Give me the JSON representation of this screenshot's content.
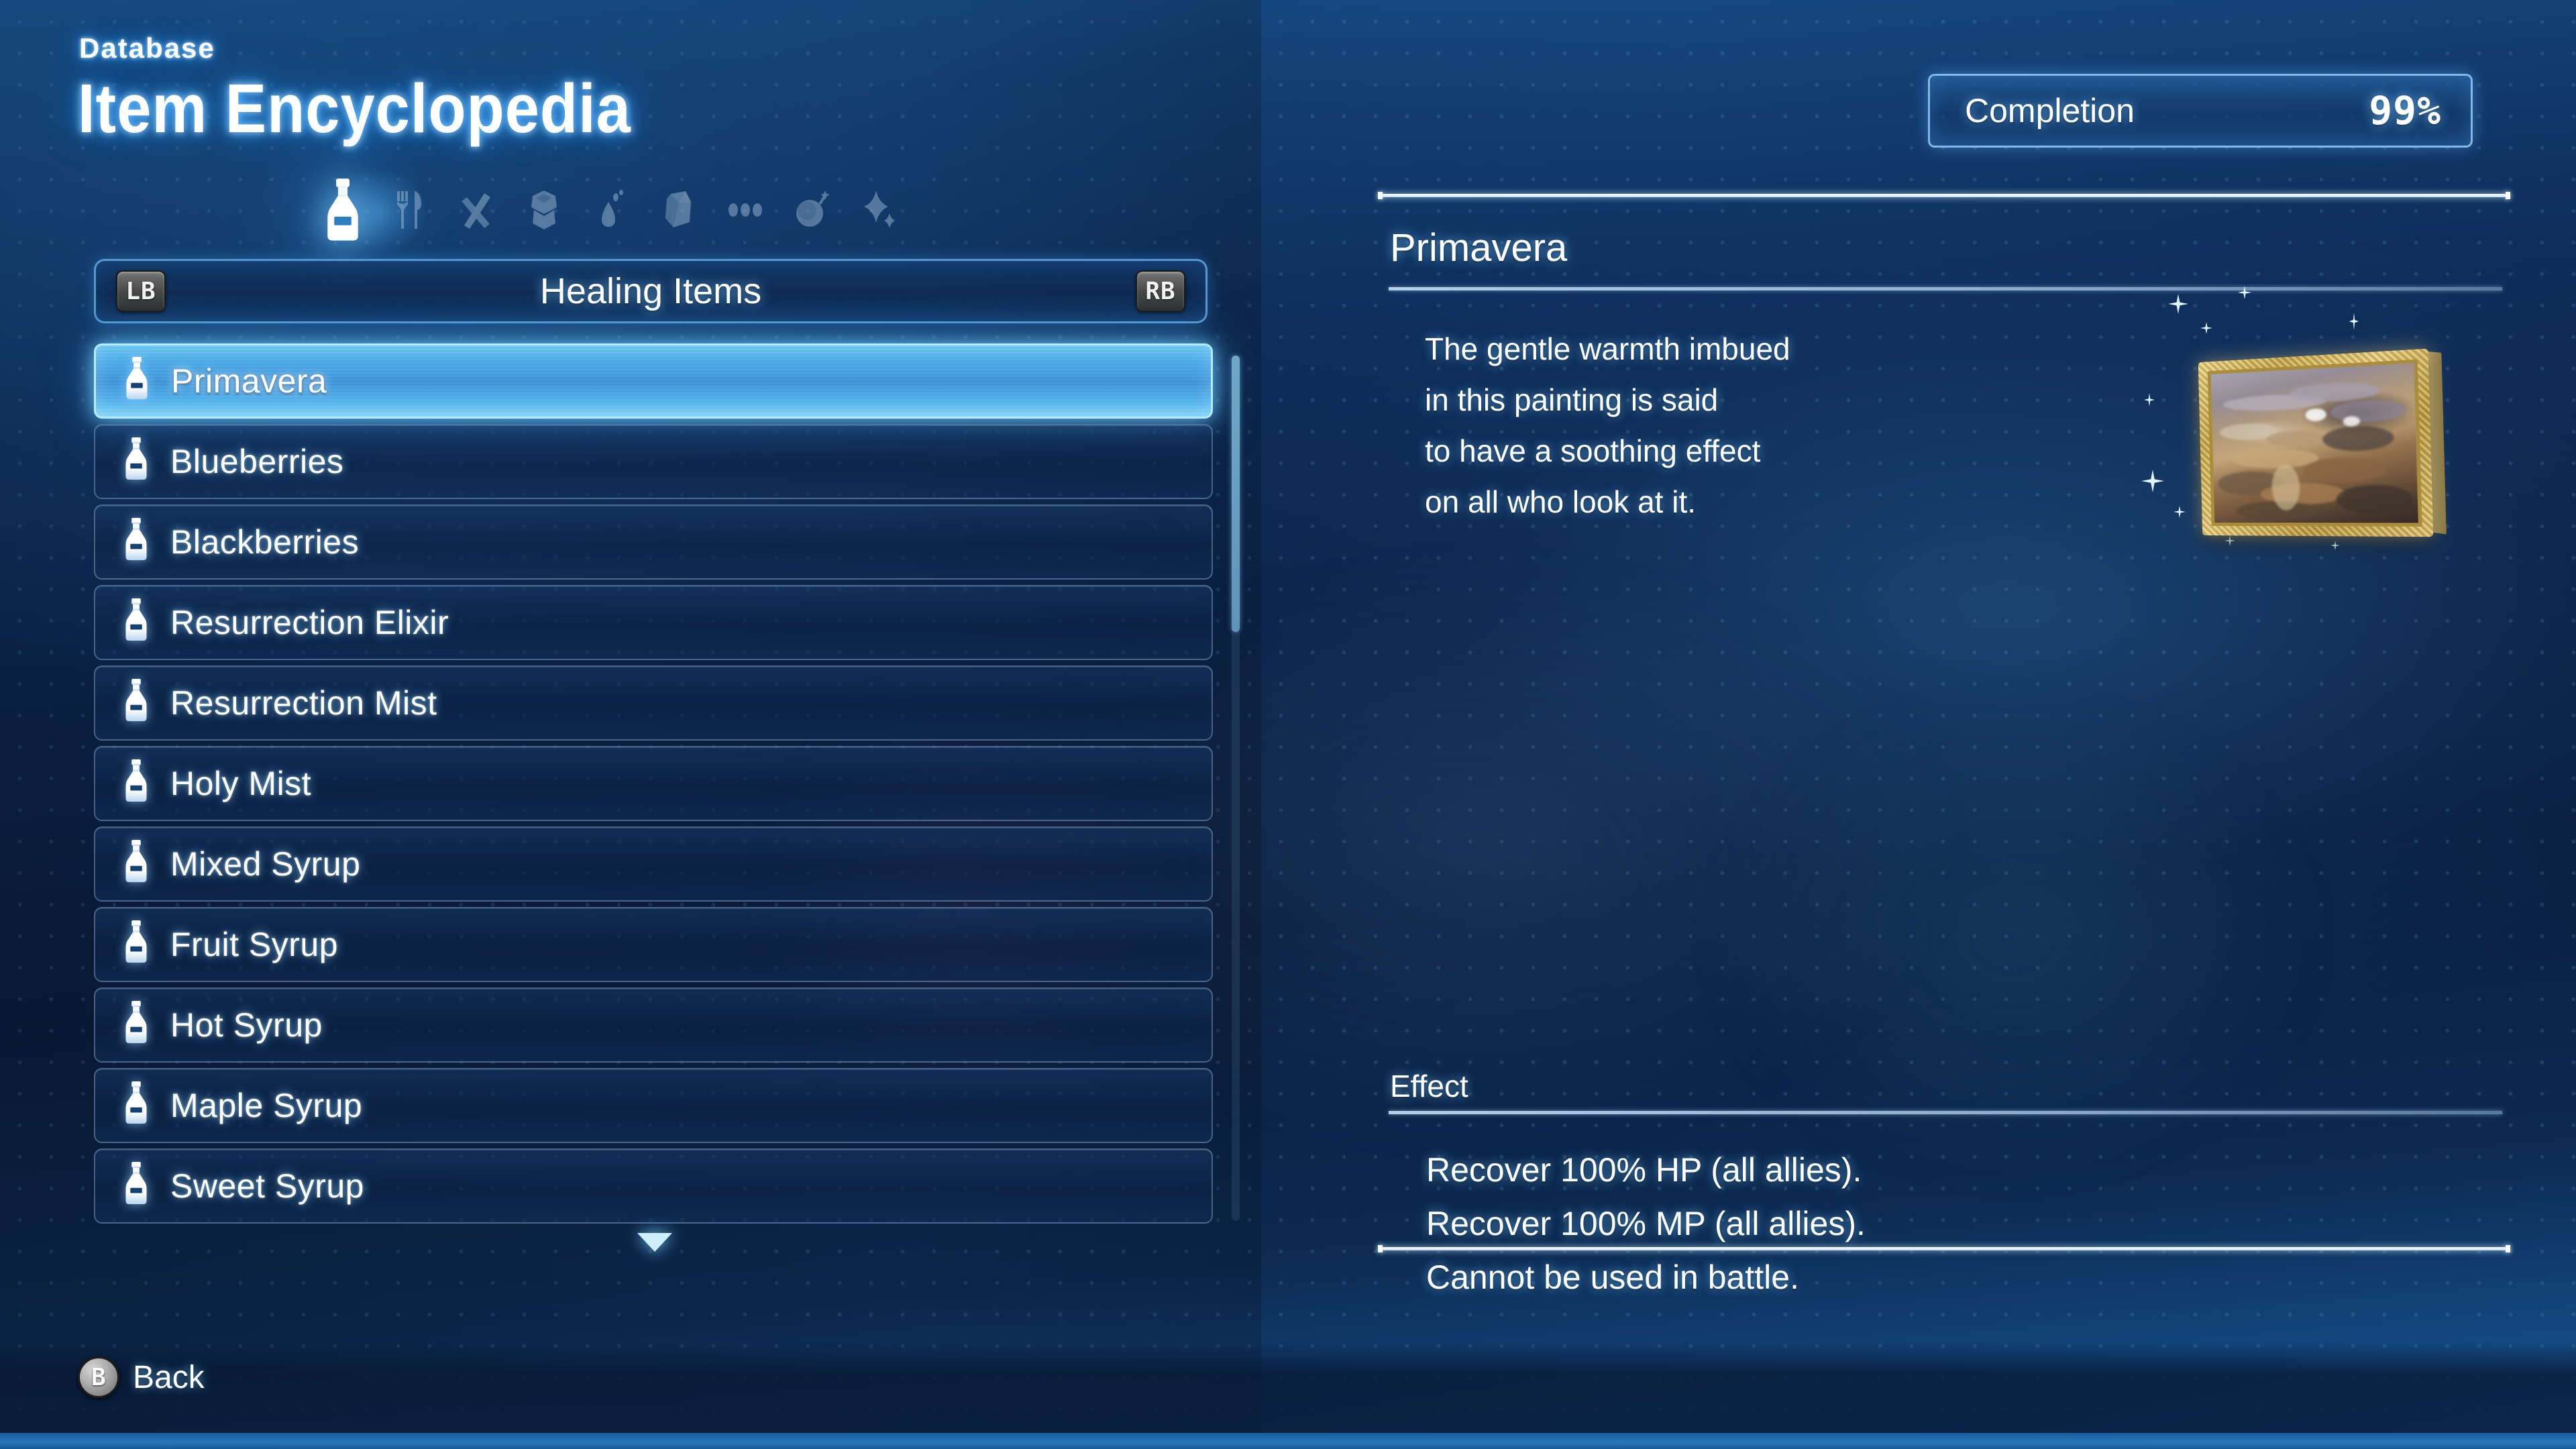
{
  "header": {
    "kicker": "Database",
    "title": "Item Encyclopedia",
    "completion_label": "Completion",
    "completion_value": "99%"
  },
  "categories": {
    "bumper_left": "LB",
    "bumper_right": "RB",
    "current_tab": "Healing Items",
    "icons": [
      {
        "name": "bottle-icon",
        "active": true
      },
      {
        "name": "fork-knife-icon",
        "active": false
      },
      {
        "name": "weapons-icon",
        "active": false
      },
      {
        "name": "armor-icon",
        "active": false
      },
      {
        "name": "droplet-icon",
        "active": false
      },
      {
        "name": "gem-icon",
        "active": false
      },
      {
        "name": "ellipsis-icon",
        "active": false
      },
      {
        "name": "bomb-icon",
        "active": false
      },
      {
        "name": "sparkle-icon",
        "active": false
      }
    ]
  },
  "item_list": {
    "selected_index": 0,
    "items": [
      {
        "label": "Primavera"
      },
      {
        "label": "Blueberries"
      },
      {
        "label": "Blackberries"
      },
      {
        "label": "Resurrection Elixir"
      },
      {
        "label": "Resurrection Mist"
      },
      {
        "label": "Holy Mist"
      },
      {
        "label": "Mixed Syrup"
      },
      {
        "label": "Fruit Syrup"
      },
      {
        "label": "Hot Syrup"
      },
      {
        "label": "Maple Syrup"
      },
      {
        "label": "Sweet Syrup"
      }
    ]
  },
  "detail": {
    "title": "Primavera",
    "flavor_lines": [
      "The gentle warmth imbued",
      "in this painting is said",
      "to have a soothing effect",
      "on all who look at it."
    ],
    "effect_label": "Effect",
    "effect_lines": [
      "Recover 100% HP (all allies).",
      "Recover 100% MP (all allies).",
      "Cannot be used in battle."
    ],
    "artwork_name": "framed-mountain-painting"
  },
  "footer": {
    "back_button_glyph": "B",
    "back_label": "Back"
  },
  "colors": {
    "accent_cyan": "#7fd2f7",
    "selected_blue": "#4aa9e6",
    "panel_border": "#6eb9f5",
    "text_white": "#ffffff",
    "frame_gold": "#c8a84e"
  }
}
